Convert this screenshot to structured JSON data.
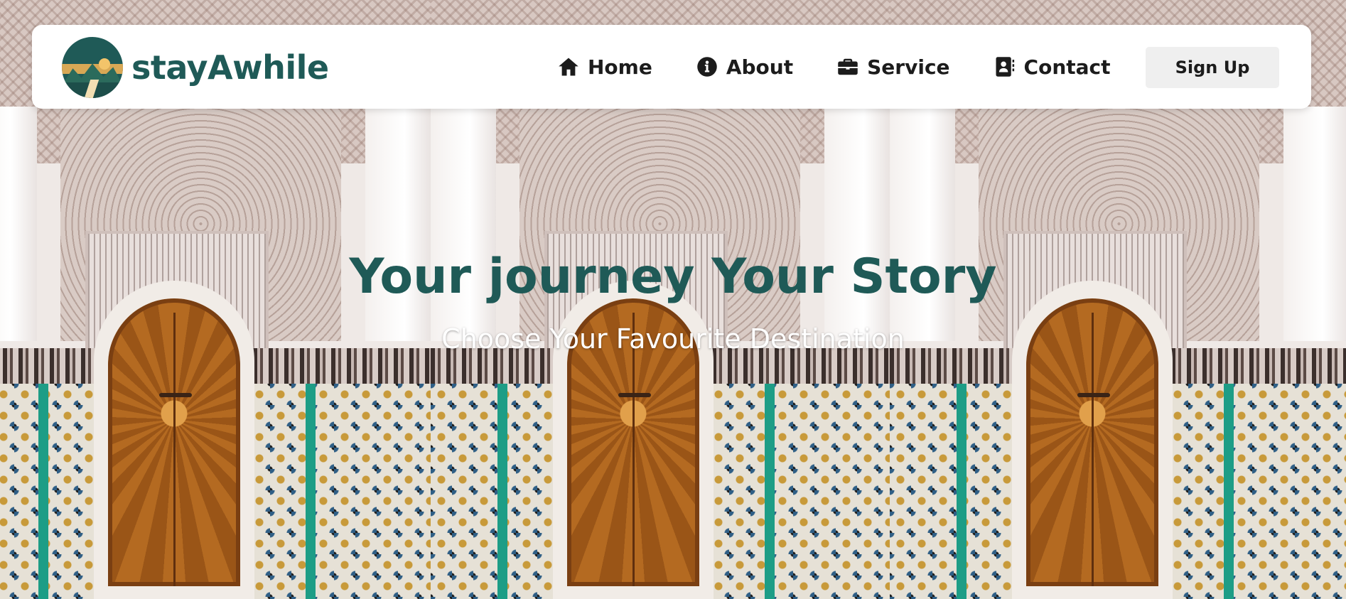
{
  "brand": {
    "name": "stayAwhile",
    "logo_icon": "mountain-sunset-logo-icon"
  },
  "nav": {
    "items": [
      {
        "label": "Home",
        "icon": "home-icon"
      },
      {
        "label": "About",
        "icon": "info-circle-icon"
      },
      {
        "label": "Service",
        "icon": "briefcase-icon"
      },
      {
        "label": "Contact",
        "icon": "address-card-icon"
      }
    ],
    "signup_label": "Sign Up"
  },
  "hero": {
    "title": "Your journey Your Story",
    "subtitle": "Choose Your Favourite Destination"
  },
  "colors": {
    "brand": "#1f5a57",
    "navbar_bg": "#ffffff",
    "button_bg": "#efefef",
    "text_dark": "#1c1c1c",
    "subtitle": "#ffffff"
  }
}
